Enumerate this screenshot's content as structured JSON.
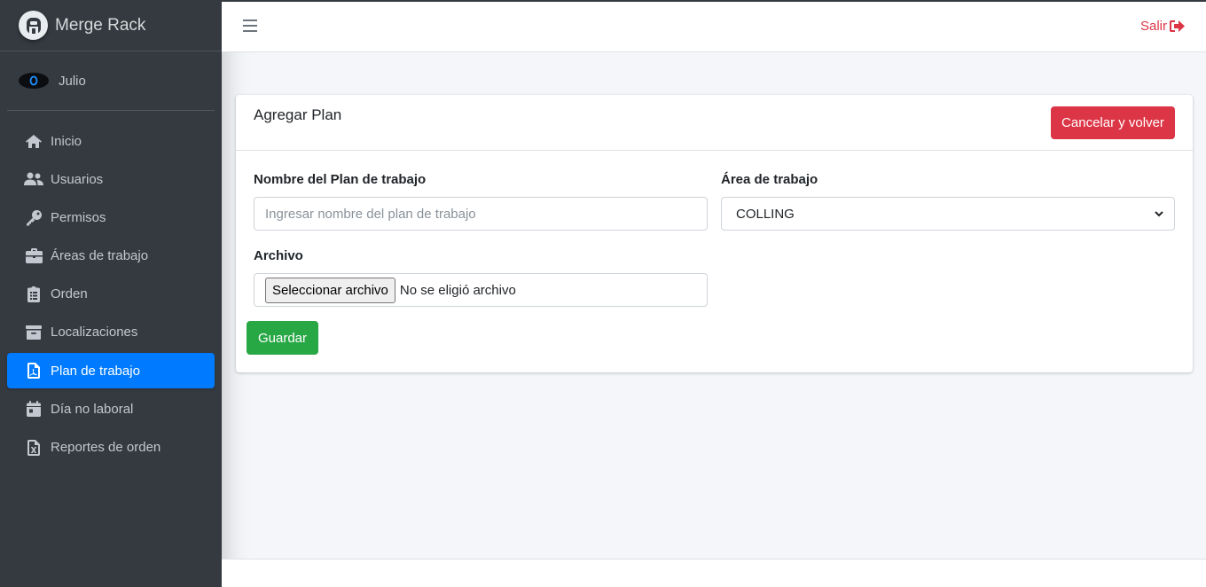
{
  "brand": {
    "name": "Merge Rack",
    "logo_icon": "brand-logo-icon"
  },
  "user": {
    "name": "Julio"
  },
  "sidebar": {
    "items": [
      {
        "label": "Inicio",
        "icon": "home-icon"
      },
      {
        "label": "Usuarios",
        "icon": "users-icon"
      },
      {
        "label": "Permisos",
        "icon": "key-icon"
      },
      {
        "label": "Áreas de trabajo",
        "icon": "briefcase-icon"
      },
      {
        "label": "Orden",
        "icon": "clipboard-list-icon"
      },
      {
        "label": "Localizaciones",
        "icon": "archive-icon"
      },
      {
        "label": "Plan de trabajo",
        "icon": "file-pdf-icon",
        "active": true
      },
      {
        "label": "Día no laboral",
        "icon": "calendar-icon"
      },
      {
        "label": "Reportes de orden",
        "icon": "file-excel-icon"
      }
    ],
    "active_color": "#007bff",
    "background": "#343a40"
  },
  "topbar": {
    "logout_label": "Salir"
  },
  "card": {
    "title": "Agregar Plan",
    "cancel_label": "Cancelar y volver",
    "fields": {
      "plan_name": {
        "label": "Nombre del Plan de trabajo",
        "placeholder": "Ingresar nombre del plan de trabajo",
        "value": ""
      },
      "area": {
        "label": "Área de trabajo",
        "selected": "COLLING"
      },
      "file": {
        "label": "Archivo",
        "button_label": "Seleccionar archivo",
        "status": "No se eligió archivo"
      }
    },
    "save_label": "Guardar"
  },
  "colors": {
    "danger": "#dc3545",
    "success": "#28a745",
    "primary": "#007bff"
  }
}
